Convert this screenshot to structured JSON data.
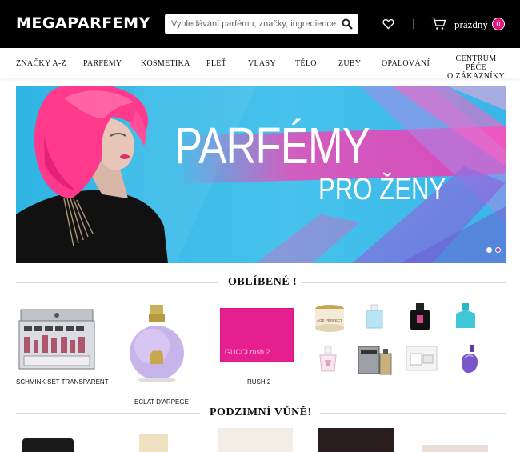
{
  "header": {
    "logo": "MEGAPARFEMY",
    "search_placeholder": "Vyhledávání parfému, značky, ingredience...",
    "cart_label": "prázdný",
    "cart_count": "0"
  },
  "nav": {
    "items": [
      "ZNAČKY A-Z",
      "PARFÉMY",
      "KOSMETIKA",
      "PLEŤ",
      "VLASY",
      "TĚLO",
      "ZUBY",
      "OPALOVÁNÍ"
    ],
    "service_line1": "CENTRUM PÉČE",
    "service_line2": "O ZÁKAZNÍKY"
  },
  "banner": {
    "title": "PARFÉMY",
    "subtitle": "PRO ŽENY",
    "slides_total": 2,
    "slide_active": 2
  },
  "sections": [
    {
      "title": "OBLÍBENÉ !"
    },
    {
      "title": "PODZIMNÍ VŮNĚ!"
    }
  ],
  "popular": {
    "products": [
      {
        "label": "SCHMINK SET TRANSPARENT"
      },
      {
        "label": "ECLAT D'ARPEGE"
      },
      {
        "label": "RUSH 2"
      }
    ],
    "rush_box_text": "GUCCI rush 2",
    "age_perfect_text": "AGE PERFECT"
  },
  "colors": {
    "accent": "#e2137e",
    "header_bg": "#000000",
    "banner_bg": "#36b9e6"
  }
}
